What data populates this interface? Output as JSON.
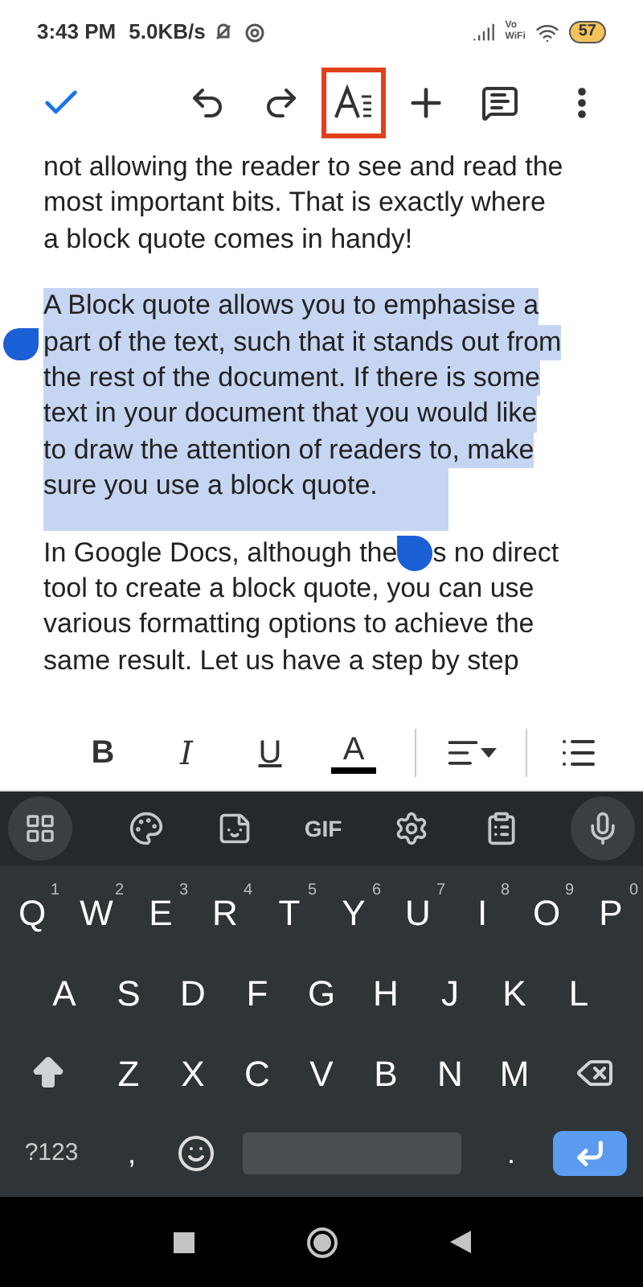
{
  "status_bar": {
    "time": "3:43 PM",
    "speed": "5.0KB/s",
    "vowifi": [
      "Vo",
      "WiFi"
    ],
    "battery": "57"
  },
  "toolbar": {
    "buttons": [
      {
        "highlighted": false
      },
      {
        "highlighted": false
      },
      {
        "highlighted": false
      },
      {
        "highlighted": true
      },
      {
        "highlighted": false
      },
      {
        "highlighted": false
      },
      {
        "highlighted": false
      }
    ]
  },
  "document": {
    "paragraphs": [
      {
        "selected": false,
        "lines": [
          [
            {
              "text": "not allowing the reader to see and read the"
            }
          ],
          [
            {
              "text": "most important bits. That is exactly where"
            }
          ],
          [
            {
              "text": "a block quote comes in handy!"
            }
          ]
        ]
      },
      {
        "selected": true,
        "lines": [
          [
            {
              "text": "A Block quote allows you to emphasise a"
            }
          ],
          [
            {
              "text": "part of the text, such that it stands out from"
            }
          ],
          [
            {
              "text": "the rest of the document. If there is some"
            }
          ],
          [
            {
              "text": "text in your document that you would like"
            }
          ],
          [
            {
              "text": "to draw the attention of readers to, make"
            }
          ],
          [
            {
              "text": "sure you use a block quote."
            }
          ]
        ]
      },
      {
        "selected": false,
        "lines": [
          [
            {
              "text": "In Google Docs, although the"
            },
            {
              "text": "s no direct",
              "handle_before": true
            }
          ],
          [
            {
              "text": "tool to create a block quote, you can use"
            }
          ],
          [
            {
              "text": "various formatting options to achieve the"
            }
          ],
          [
            {
              "text": "same result. Let us have a step by step"
            }
          ]
        ]
      }
    ]
  },
  "format_bar": {
    "bold": "B",
    "italic": "I",
    "underline": "U",
    "text_color": "A"
  },
  "keyboard": {
    "strip_gif": "GIF",
    "rows": [
      [
        {
          "key": "Q",
          "hint": "1"
        },
        {
          "key": "W",
          "hint": "2"
        },
        {
          "key": "E",
          "hint": "3"
        },
        {
          "key": "R",
          "hint": "4"
        },
        {
          "key": "T",
          "hint": "5"
        },
        {
          "key": "Y",
          "hint": "6"
        },
        {
          "key": "U",
          "hint": "7"
        },
        {
          "key": "I",
          "hint": "8"
        },
        {
          "key": "O",
          "hint": "9"
        },
        {
          "key": "P",
          "hint": "0"
        }
      ],
      [
        {
          "key": "A"
        },
        {
          "key": "S"
        },
        {
          "key": "D"
        },
        {
          "key": "F"
        },
        {
          "key": "G"
        },
        {
          "key": "H"
        },
        {
          "key": "J"
        },
        {
          "key": "K"
        },
        {
          "key": "L"
        }
      ],
      [
        {
          "key": "Z"
        },
        {
          "key": "X"
        },
        {
          "key": "C"
        },
        {
          "key": "V"
        },
        {
          "key": "B"
        },
        {
          "key": "N"
        },
        {
          "key": "M"
        }
      ]
    ],
    "symbols": "?123",
    "comma": ",",
    "period": "."
  }
}
